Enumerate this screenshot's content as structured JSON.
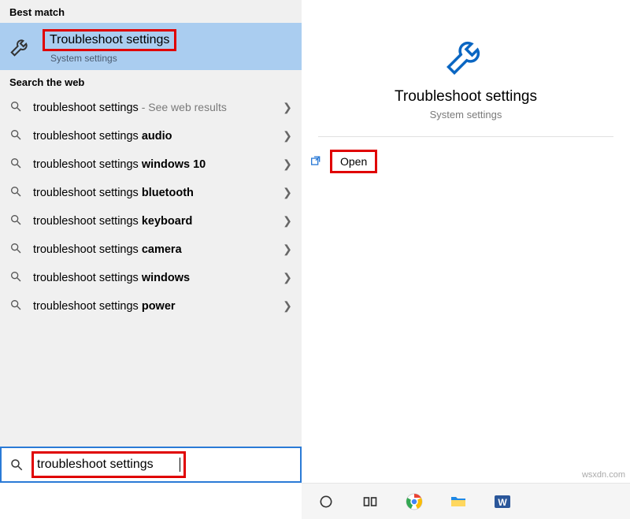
{
  "sections": {
    "best_match_label": "Best match",
    "search_web_label": "Search the web"
  },
  "best_match": {
    "title": "Troubleshoot settings",
    "subtitle": "System settings"
  },
  "web_results": [
    {
      "prefix": "troubleshoot settings",
      "bold": "",
      "hint": " - See web results"
    },
    {
      "prefix": "troubleshoot settings ",
      "bold": "audio",
      "hint": ""
    },
    {
      "prefix": "troubleshoot settings ",
      "bold": "windows 10",
      "hint": ""
    },
    {
      "prefix": "troubleshoot settings ",
      "bold": "bluetooth",
      "hint": ""
    },
    {
      "prefix": "troubleshoot settings ",
      "bold": "keyboard",
      "hint": ""
    },
    {
      "prefix": "troubleshoot settings ",
      "bold": "camera",
      "hint": ""
    },
    {
      "prefix": "troubleshoot settings ",
      "bold": "windows",
      "hint": ""
    },
    {
      "prefix": "troubleshoot settings ",
      "bold": "power",
      "hint": ""
    }
  ],
  "search_input": {
    "value": "troubleshoot settings"
  },
  "preview": {
    "title": "Troubleshoot settings",
    "subtitle": "System settings",
    "open_label": "Open"
  },
  "watermark": "wsxdn.com",
  "colors": {
    "highlight": "#e00000",
    "selection": "#aacdf0",
    "accent": "#2a7ad6"
  }
}
